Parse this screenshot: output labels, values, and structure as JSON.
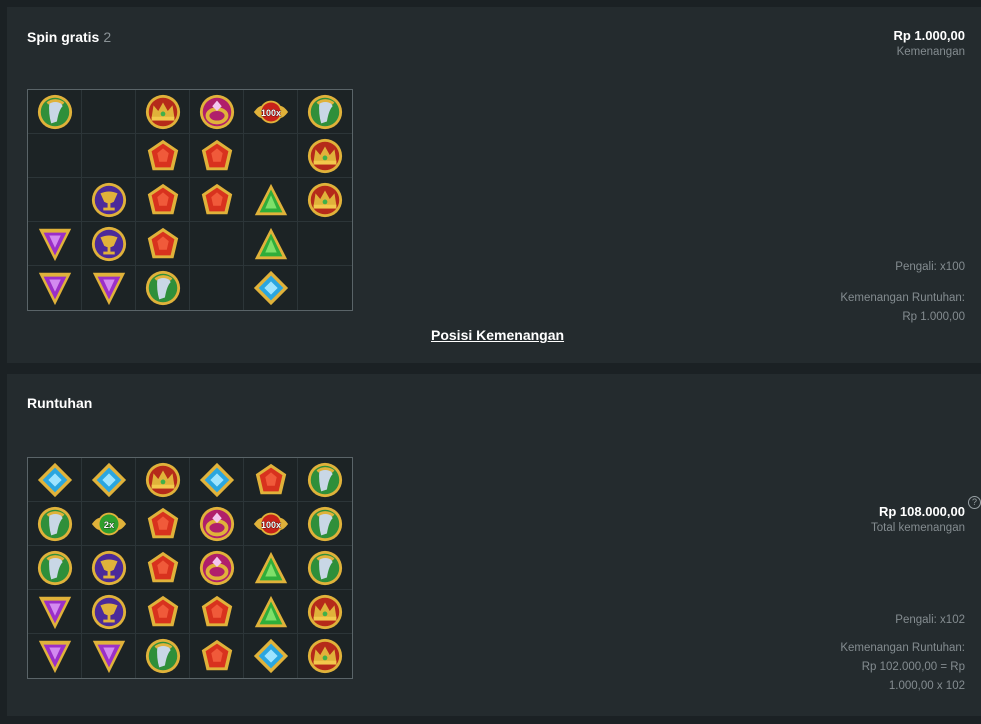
{
  "round1": {
    "title": "Spin gratis",
    "count": "2",
    "amount": "Rp 1.000,00",
    "amount_label": "Kemenangan",
    "multiplier": "Pengali: x100",
    "cascade_label": "Kemenangan Runtuhan:",
    "cascade_value": "Rp 1.000,00",
    "link": "Posisi Kemenangan",
    "grid": [
      [
        "urn",
        "",
        "crown",
        "ring",
        "mult",
        "urn"
      ],
      [
        "",
        "",
        "ruby",
        "ruby",
        "",
        "crown"
      ],
      [
        "",
        "chalice",
        "ruby",
        "ruby",
        "emerald",
        "crown"
      ],
      [
        "amethyst",
        "chalice",
        "ruby",
        "",
        "emerald",
        ""
      ],
      [
        "amethyst",
        "amethyst",
        "urn",
        "",
        "sapphire",
        ""
      ]
    ],
    "multiplier_label": "100x"
  },
  "round2": {
    "title": "Runtuhan",
    "amount": "Rp 108.000,00",
    "amount_label": "Total kemenangan",
    "help_glyph": "?",
    "multiplier": "Pengali: x102",
    "cascade_label": "Kemenangan Runtuhan:",
    "cascade_line1": "Rp 102.000,00 = Rp",
    "cascade_line2": "1.000,00 x 102",
    "grid": [
      [
        "sapphire",
        "sapphire",
        "crown",
        "sapphire",
        "ruby",
        "urn"
      ],
      [
        "urn",
        "mult2",
        "ruby",
        "ring",
        "mult",
        "urn"
      ],
      [
        "urn",
        "chalice",
        "ruby",
        "ring",
        "emerald",
        "urn"
      ],
      [
        "amethyst",
        "chalice",
        "ruby",
        "ruby",
        "emerald",
        "crown"
      ],
      [
        "amethyst",
        "amethyst",
        "urn",
        "ruby",
        "sapphire",
        "crown"
      ]
    ],
    "multiplier_labels": {
      "mult2": "2x",
      "mult": "100x"
    }
  },
  "colors": {
    "panel": "#242b2e",
    "background": "#1b2124",
    "muted_text": "#848c90",
    "gold": "#e0b23a",
    "ruby": "#d8321e",
    "emerald": "#2fae3a",
    "sapphire": "#2aa6e0",
    "amethyst": "#9b2fc8",
    "chalice": "#4b2a9a",
    "urn": "#2f8f3a",
    "ring": "#b01f6b",
    "crown": "#b52a1a"
  }
}
